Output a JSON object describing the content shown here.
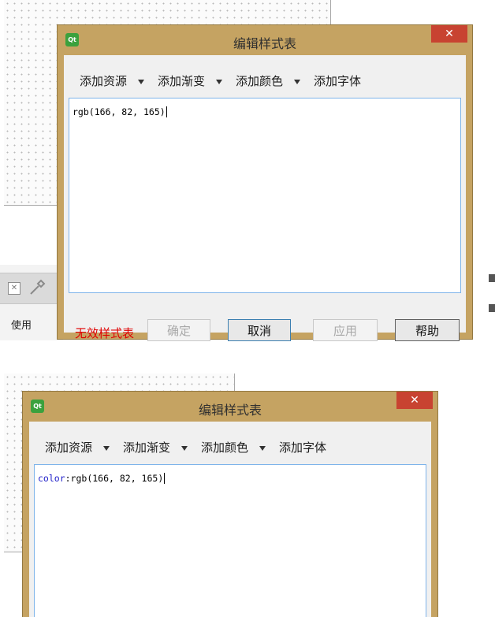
{
  "top_dialog": {
    "title": "编辑样式表",
    "app_icon": "qt-logo-icon",
    "close_icon": "close-icon",
    "logo_text": "Qt",
    "toolbar": [
      "添加资源",
      "添加渐变",
      "添加颜色",
      "添加字体"
    ],
    "editor_text": "rgb(166, 82, 165)",
    "status": "无效样式表",
    "buttons": {
      "ok": "确定",
      "cancel": "取消",
      "apply": "应用",
      "help": "帮助"
    }
  },
  "bottom_dialog": {
    "title": "编辑样式表",
    "logo_text": "Qt",
    "toolbar": [
      "添加资源",
      "添加渐变",
      "添加颜色",
      "添加字体"
    ],
    "editor_keyword": "color",
    "editor_text": ":rgb(166, 82, 165)"
  },
  "background": {
    "use_tab": "使用",
    "tool_icons": [
      "close-file-icon",
      "wrench-icon"
    ]
  },
  "colors": {
    "dialog_frame": "#c5a362",
    "close_button": "#c84331",
    "status_error": "#e00000",
    "editor_border": "#7eb4ea",
    "keyword": "#1a1ac8"
  }
}
